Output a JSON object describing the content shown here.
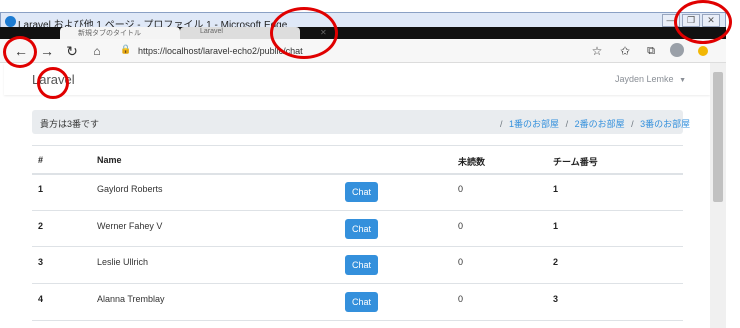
{
  "window": {
    "title": "Laravel および他 1 ページ - プロファイル 1 - Microsoft Edge",
    "controls": {
      "minimize": "—",
      "restore": "❐",
      "close": "✕"
    }
  },
  "browser": {
    "url": "https://localhost/laravel-echo2/public/chat",
    "tabs": [
      {
        "label": "新規タブのタイトル"
      },
      {
        "label": "Laravel"
      }
    ],
    "icons": [
      "back-icon",
      "forward-icon",
      "refresh-icon",
      "home-icon",
      "lock-icon",
      "favorite-add-icon",
      "favorites-icon",
      "collections-icon",
      "profile-avatar-icon"
    ]
  },
  "app": {
    "brand": "Laravel",
    "user": "Jayden Lemke"
  },
  "breadcrumb": {
    "info": "貴方は3番です",
    "links": [
      "1番のお部屋",
      "2番のお部屋",
      "3番のお部屋"
    ],
    "separator": "/"
  },
  "table": {
    "headers": [
      "#",
      "Name",
      "未読数",
      "チーム番号"
    ],
    "button_label": "Chat",
    "rows": [
      {
        "id": "1",
        "name": "Gaylord Roberts",
        "unread": "0",
        "team": "1"
      },
      {
        "id": "2",
        "name": "Werner Fahey V",
        "unread": "0",
        "team": "1"
      },
      {
        "id": "3",
        "name": "Leslie Ullrich",
        "unread": "0",
        "team": "2"
      },
      {
        "id": "4",
        "name": "Alanna Tremblay",
        "unread": "0",
        "team": "3"
      }
    ]
  },
  "colors": {
    "accent": "#3490dc",
    "annotation": "#e00000"
  }
}
